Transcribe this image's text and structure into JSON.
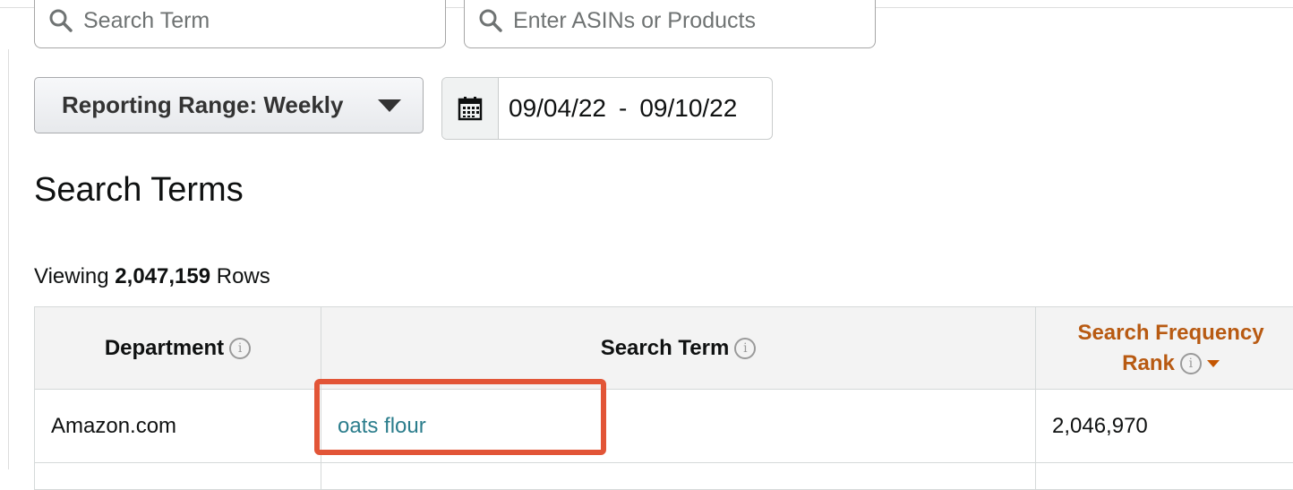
{
  "filters": {
    "search_term_placeholder": "Search Term",
    "asin_placeholder": "Enter ASINs or Products",
    "reporting_range_label": "Reporting Range: Weekly",
    "date_start": "09/04/22",
    "date_separator": "-",
    "date_end": "09/10/22"
  },
  "page": {
    "title": "Search Terms",
    "viewing_prefix": "Viewing",
    "row_count": "2,047,159",
    "viewing_suffix": "Rows"
  },
  "table": {
    "headers": {
      "department": "Department",
      "search_term": "Search Term",
      "sfr_line1": "Search Frequency",
      "sfr_line2": "Rank"
    },
    "rows": [
      {
        "department": "Amazon.com",
        "search_term": "oats flour",
        "rank": "2,046,970"
      }
    ]
  },
  "colors": {
    "link": "#2b7d8c",
    "sort_header": "#b85a12",
    "highlight": "#e25537"
  },
  "icons": [
    "search-icon",
    "calendar-icon",
    "dropdown-caret-icon",
    "info-icon",
    "sort-desc-icon"
  ]
}
